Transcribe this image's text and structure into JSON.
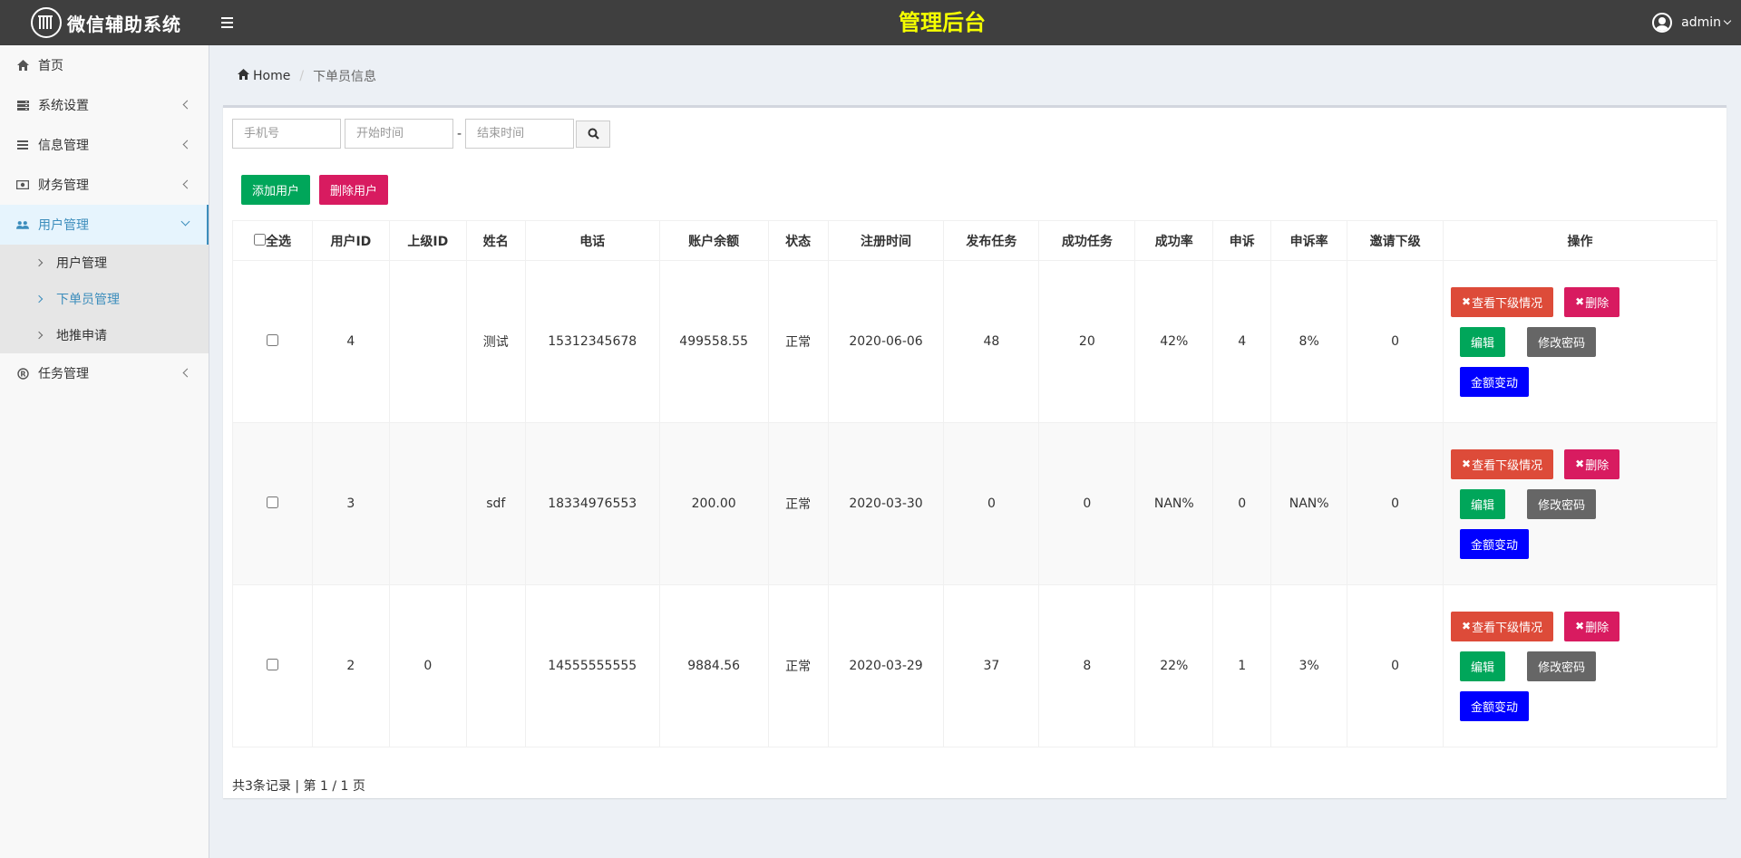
{
  "header": {
    "logo_text": "微信辅助系统",
    "title": "管理后台",
    "user": "admin",
    "title_color": "#f5ff00"
  },
  "sidebar": {
    "items": [
      {
        "label": "首页",
        "icon": "home-icon"
      },
      {
        "label": "系统设置",
        "icon": "server-icon"
      },
      {
        "label": "信息管理",
        "icon": "list-icon"
      },
      {
        "label": "财务管理",
        "icon": "money-icon"
      },
      {
        "label": "用户管理",
        "icon": "users-icon"
      },
      {
        "label": "任务管理",
        "icon": "registered-icon"
      }
    ],
    "submenu": [
      "用户管理",
      "下单员管理",
      "地推申请"
    ]
  },
  "breadcrumb": {
    "home": "Home",
    "current": "下单员信息"
  },
  "search": {
    "phone_placeholder": "手机号",
    "start_placeholder": "开始时间",
    "end_placeholder": "结束时间",
    "separator": "-"
  },
  "actions": {
    "add": "添加用户",
    "delete": "删除用户"
  },
  "table": {
    "select_all": "全选",
    "headers": [
      "用户ID",
      "上级ID",
      "姓名",
      "电话",
      "账户余额",
      "状态",
      "注册时间",
      "发布任务",
      "成功任务",
      "成功率",
      "申诉",
      "申诉率",
      "邀请下级",
      "操作"
    ],
    "rows": [
      {
        "id": "4",
        "parent": "",
        "name": "测试",
        "phone": "15312345678",
        "balance": "499558.55",
        "status": "正常",
        "reg": "2020-06-06",
        "pub": "48",
        "succ": "20",
        "rate": "42%",
        "appeal": "4",
        "appeal_rate": "8%",
        "invite": "0"
      },
      {
        "id": "3",
        "parent": "",
        "name": "sdf",
        "phone": "18334976553",
        "balance": "200.00",
        "status": "正常",
        "reg": "2020-03-30",
        "pub": "0",
        "succ": "0",
        "rate": "NAN%",
        "appeal": "0",
        "appeal_rate": "NAN%",
        "invite": "0"
      },
      {
        "id": "2",
        "parent": "0",
        "name": "",
        "phone": "14555555555",
        "balance": "9884.56",
        "status": "正常",
        "reg": "2020-03-29",
        "pub": "37",
        "succ": "8",
        "rate": "22%",
        "appeal": "1",
        "appeal_rate": "3%",
        "invite": "0"
      }
    ],
    "ops": {
      "view": "查看下级情况",
      "delete": "删除",
      "edit": "编辑",
      "password": "修改密码",
      "balance": "金额变动"
    }
  },
  "pagination": {
    "summary": "共3条记录 | 第 1 / 1 页"
  }
}
